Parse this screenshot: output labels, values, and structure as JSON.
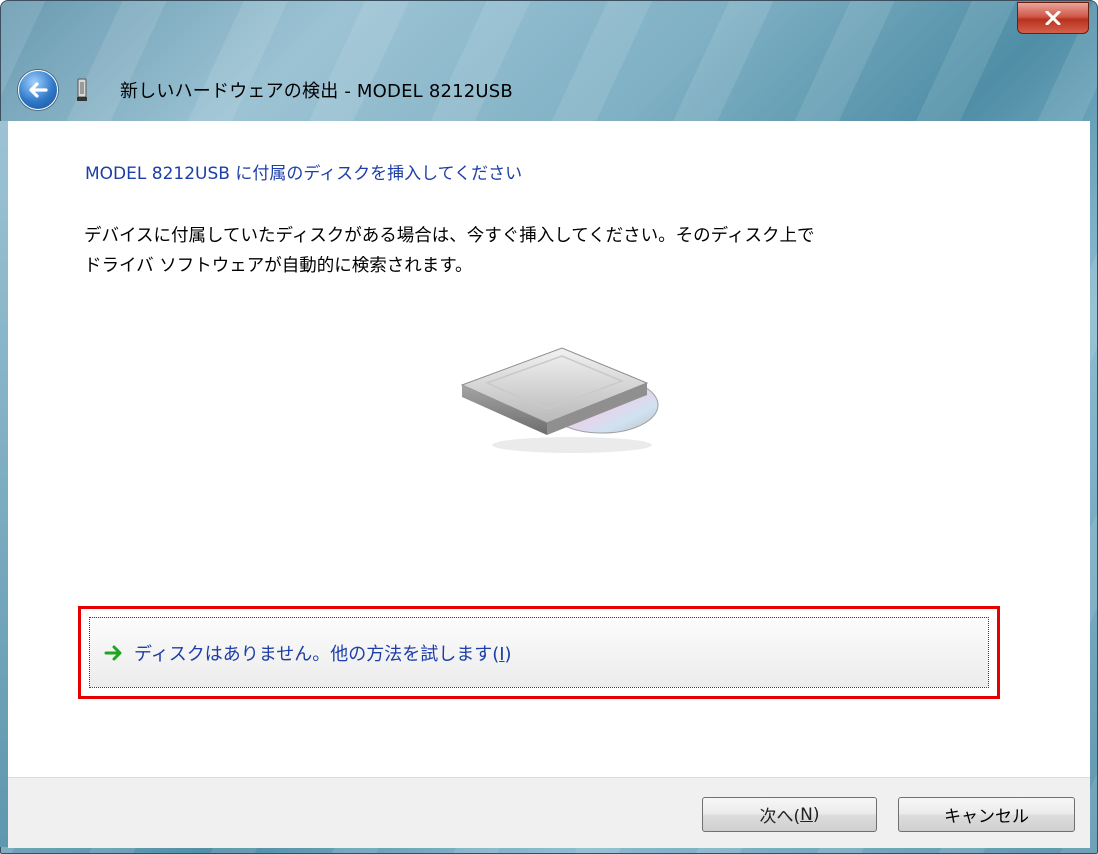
{
  "window": {
    "title": "新しいハードウェアの検出 - MODEL 8212USB",
    "close_label": "x"
  },
  "content": {
    "heading": "MODEL 8212USB に付属のディスクを挿入してください",
    "description_line1": "デバイスに付属していたディスクがある場合は、今すぐ挿入してください。そのディスク上で",
    "description_line2": "ドライバ ソフトウェアが自動的に検索されます。",
    "option_text": "ディスクはありません。他の方法を試します(",
    "option_key": "I",
    "option_end": ")"
  },
  "buttons": {
    "next_label": "次へ(",
    "next_key": "N",
    "next_end": ")",
    "cancel_label": "キャンセル"
  },
  "colors": {
    "link": "#1d3ea8",
    "highlight": "#e80000",
    "arrow": "#1fa51f"
  }
}
